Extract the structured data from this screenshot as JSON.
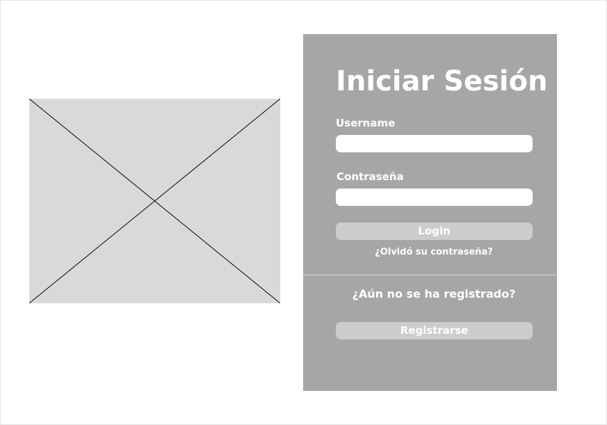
{
  "login": {
    "title": "Iniciar Sesión",
    "username_label": "Username",
    "username_value": "",
    "password_label": "Contraseña",
    "password_value": "",
    "login_button": "Login",
    "forgot_password": "¿Olvidó su contraseña?"
  },
  "register": {
    "prompt": "¿Aún no se ha registrado?",
    "button": "Registrarse"
  },
  "colors": {
    "panel_background": "#a6a6a6",
    "button_background": "#cccccc",
    "placeholder_background": "#d9d9d9",
    "text": "#ffffff"
  },
  "icons": {
    "image_placeholder": "image-placeholder-icon"
  }
}
